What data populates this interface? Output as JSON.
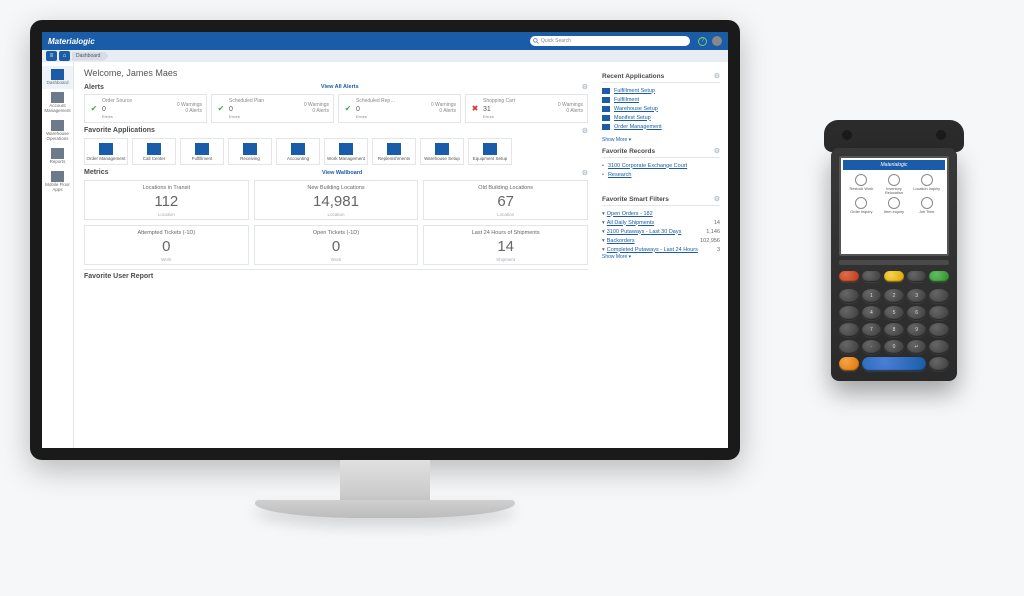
{
  "brand": "Materialogic",
  "search_placeholder": "Quick Search",
  "breadcrumb": "Dashboard",
  "welcome": "Welcome, James Maes",
  "sidebar": [
    {
      "label": "Dashboard",
      "active": true
    },
    {
      "label": "Account Management"
    },
    {
      "label": "Warehouse Operations"
    },
    {
      "label": "Reports"
    },
    {
      "label": "Mobile Floor Apps"
    }
  ],
  "alerts": {
    "title": "Alerts",
    "view_all": "View All Alerts",
    "items": [
      {
        "name": "Order Source",
        "count": "0",
        "warn": "0 Warnings",
        "err": "0 Alerts",
        "ok": true
      },
      {
        "name": "Scheduled Plan",
        "count": "0",
        "warn": "0 Warnings",
        "err": "0 Alerts",
        "ok": true
      },
      {
        "name": "Scheduled Rep…",
        "count": "0",
        "warn": "0 Warnings",
        "err": "0 Alerts",
        "ok": true
      },
      {
        "name": "Shopping Cart",
        "count": "31",
        "warn": "0 Warnings",
        "err": "0 Alerts",
        "ok": false
      }
    ]
  },
  "fav_apps": {
    "title": "Favorite Applications",
    "items": [
      "Order Management",
      "Call Center",
      "Fulfillment",
      "Receiving",
      "Accounting",
      "Work Management",
      "Replenishments",
      "Warehouse Setup",
      "Equipment Setup"
    ]
  },
  "metrics": {
    "title": "Metrics",
    "view_wallboard": "View Wallboard",
    "items": [
      {
        "title": "Locations in Transit",
        "value": "112",
        "sub": "Location"
      },
      {
        "title": "New Building Locations",
        "value": "14,981",
        "sub": "Location"
      },
      {
        "title": "Old Building Locations",
        "value": "67",
        "sub": "Location"
      },
      {
        "title": "Attempted Tickets (-1D)",
        "value": "0",
        "sub": "Work"
      },
      {
        "title": "Open Tickets (-1D)",
        "value": "0",
        "sub": "Work"
      },
      {
        "title": "Last 24 Hours of Shipments",
        "value": "14",
        "sub": "Shipment"
      }
    ]
  },
  "fav_user_report": "Favorite User Report",
  "recent_apps": {
    "title": "Recent Applications",
    "items": [
      "Fulfillment Setup",
      "Fulfillment",
      "Warehouse Setup",
      "Manifest Setup",
      "Order Management"
    ],
    "show_more": "Show More  ▾"
  },
  "fav_records": {
    "title": "Favorite Records",
    "items": [
      "3100 Corporate Exchange Court",
      "Research"
    ]
  },
  "smart_filters": {
    "title": "Favorite Smart Filters",
    "items": [
      {
        "name": "Open Orders - 182",
        "value": ""
      },
      {
        "name": "All Daily Shipments",
        "value": "14"
      },
      {
        "name": "3100 Putaways - Last 30 Days",
        "value": "1,146"
      },
      {
        "name": "Backorders",
        "value": "102,956"
      },
      {
        "name": "Completed Putaways - Last 24 Hours",
        "value": "3"
      }
    ],
    "show_more": "Show More  ▾"
  },
  "scanner": {
    "brand": "Materialogic",
    "tiles": [
      "Restock Work",
      "Inventory Relocation",
      "Location Inquiry",
      "Order Inquiry",
      "Item Inquiry",
      "Job Time"
    ]
  }
}
